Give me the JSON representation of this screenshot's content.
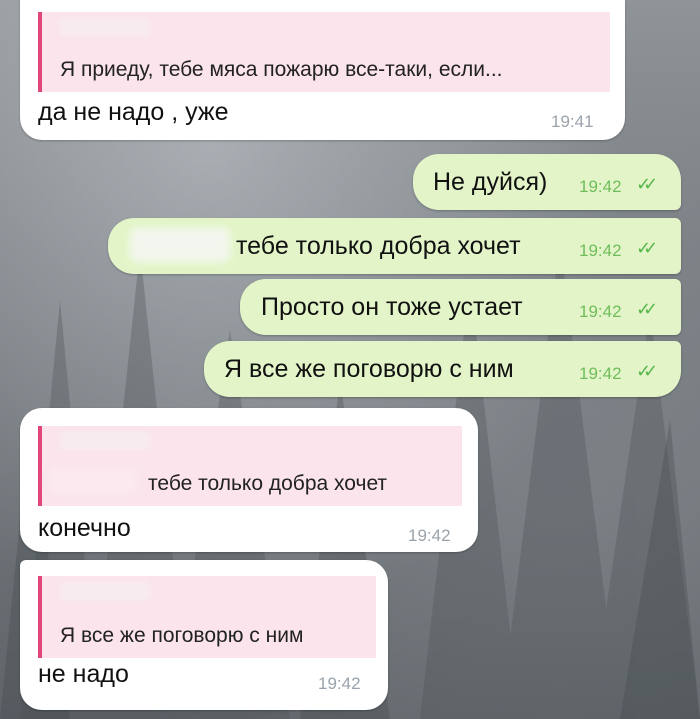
{
  "messages": [
    {
      "direction": "in",
      "reply_text": "Я приеду, тебе мяса пожарю все-таки, если...",
      "text": "да не надо , уже",
      "time": "19:41"
    },
    {
      "direction": "out",
      "text": "Не дуйся)",
      "time": "19:42",
      "status_icon": "double-check-icon"
    },
    {
      "direction": "out",
      "text": "тебе только добра хочет",
      "time": "19:42",
      "status_icon": "double-check-icon"
    },
    {
      "direction": "out",
      "text": "Просто он тоже устает",
      "time": "19:42",
      "status_icon": "double-check-icon"
    },
    {
      "direction": "out",
      "text": "Я все же поговорю с ним",
      "time": "19:42",
      "status_icon": "double-check-icon"
    },
    {
      "direction": "in",
      "reply_text": "тебе только добра хочет",
      "text": "конечно",
      "time": "19:42"
    },
    {
      "direction": "in",
      "reply_text": "Я все же поговорю с ним",
      "text": "не надо",
      "time": "19:42"
    }
  ],
  "colors": {
    "incoming_bubble": "#ffffff",
    "outgoing_bubble": "#e3f5c8",
    "reply_accent": "#e0457b",
    "reply_background": "#fbe4ec",
    "check_color": "#58b64a"
  }
}
